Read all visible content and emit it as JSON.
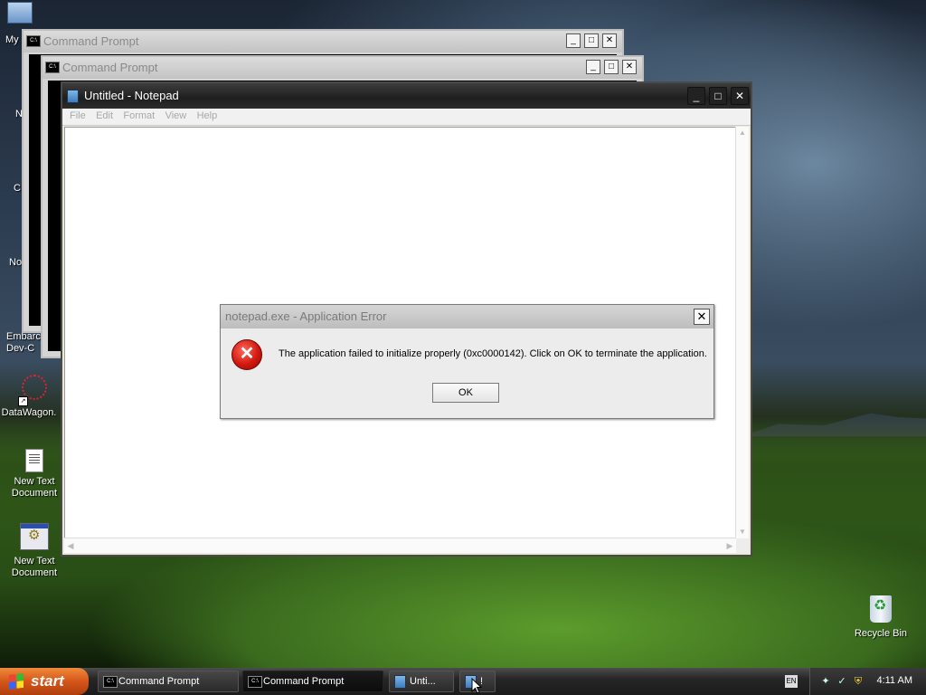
{
  "desktop": {
    "icons": [
      {
        "label": "My",
        "icon": "my-computer-icon"
      },
      {
        "label": "N",
        "icon": "partial-icon"
      },
      {
        "label": "C",
        "icon": "partial-icon"
      },
      {
        "label": "No",
        "icon": "partial-icon"
      },
      {
        "label": "Embarca\nDev-C",
        "icon": "app-icon"
      },
      {
        "label": "DataWagon.",
        "icon": "datawagon-icon"
      },
      {
        "label": "New Text\nDocument",
        "icon": "text-document-icon"
      },
      {
        "label": "New Text\nDocument",
        "icon": "config-document-icon"
      },
      {
        "label": "Recycle Bin",
        "icon": "recycle-bin-icon"
      }
    ]
  },
  "windows": {
    "cmd1": {
      "title": "Command Prompt"
    },
    "cmd2": {
      "title": "Command Prompt"
    },
    "notepad": {
      "title": "Untitled - Notepad",
      "menu": [
        "File",
        "Edit",
        "Format",
        "View",
        "Help"
      ],
      "content": ""
    }
  },
  "dialog": {
    "title": "notepad.exe - Application Error",
    "message": "The application failed to initialize properly (0xc0000142). Click on OK to terminate the application.",
    "ok_label": "OK",
    "close_glyph": "✕"
  },
  "taskbar": {
    "start_label": "start",
    "buttons": [
      {
        "label": "Command Prompt",
        "icon": "cmd-icon"
      },
      {
        "label": "Command Prompt",
        "icon": "cmd-icon",
        "active": true
      },
      {
        "label": "Unti...",
        "icon": "notepad-icon"
      },
      {
        "label": "!",
        "icon": "notepad-icon"
      }
    ],
    "language": "EN",
    "clock": "4:11 AM"
  },
  "colors": {
    "error_red": "#d2180f",
    "start_orange": "#d5561a"
  }
}
